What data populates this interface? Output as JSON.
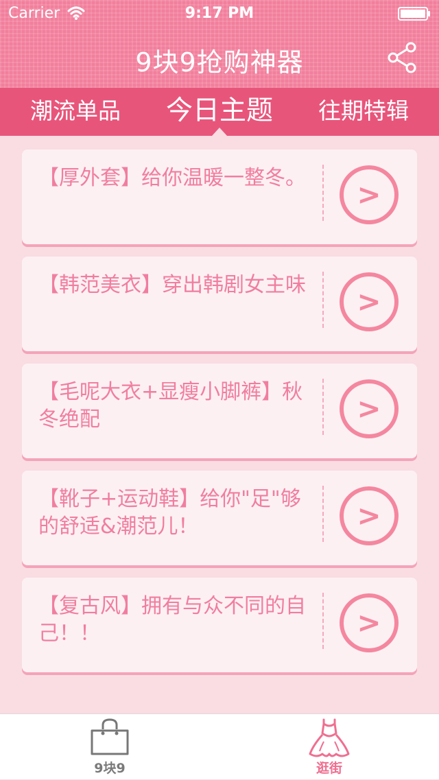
{
  "status_bar": {
    "carrier": "Carrier",
    "time": "9:17 PM",
    "wifi_icon": "wifi-icon",
    "battery_icon": "battery-icon"
  },
  "header": {
    "title": "9块9抢购神器",
    "share_icon": "share-icon"
  },
  "tabs": [
    {
      "label": "潮流单品",
      "active": false
    },
    {
      "label": "今日主题",
      "active": true
    },
    {
      "label": "往期特辑",
      "active": false
    }
  ],
  "cards": [
    {
      "text": "【厚外套】给你温暖一整冬。",
      "arrow_icon": "chevron-right-icon",
      "arrow_label": ">"
    },
    {
      "text": "【韩范美衣】穿出韩剧女主味",
      "arrow_icon": "chevron-right-icon",
      "arrow_label": ">"
    },
    {
      "text": "【毛呢大衣+显瘦小脚裤】秋冬绝配",
      "arrow_icon": "chevron-right-icon",
      "arrow_label": ">"
    },
    {
      "text": "【靴子+运动鞋】给你\"足\"够的舒适&潮范儿！",
      "arrow_icon": "chevron-right-icon",
      "arrow_label": ">"
    },
    {
      "text": "【复古风】拥有与众不同的自己！！",
      "arrow_icon": "chevron-right-icon",
      "arrow_label": ">"
    }
  ],
  "bottom_tabs": [
    {
      "label": "9块9",
      "icon": "shopping-bag-icon",
      "active": false
    },
    {
      "label": "逛街",
      "icon": "dress-icon",
      "active": true
    }
  ],
  "colors": {
    "header": "#f27f9c",
    "tab_bar": "#e8557b",
    "background": "#f9dde3",
    "card_text": "#f07ea0",
    "inactive_tab": "#7a7a7a",
    "active_tab": "#ef6f90"
  }
}
